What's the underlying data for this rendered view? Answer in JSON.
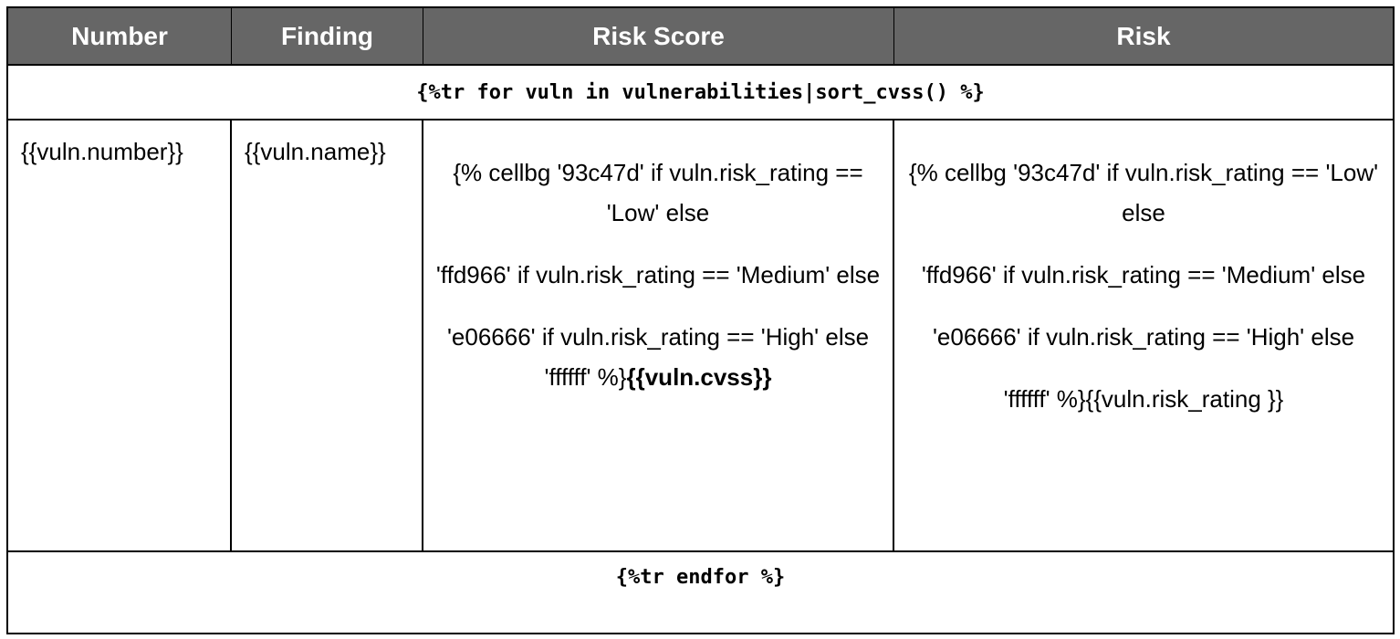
{
  "table": {
    "headers": [
      "Number",
      "Finding",
      "Risk Score",
      "Risk"
    ],
    "loop_start": "{%tr for vuln in vulnerabilities|sort_cvss() %}",
    "row": {
      "number": "{{vuln.number}}",
      "finding": "{{vuln.name}}",
      "risk_score": {
        "para1": "{% cellbg '93c47d' if vuln.risk_rating == 'Low' else",
        "para2": "'ffd966' if vuln.risk_rating == 'Medium' else",
        "para3": "'e06666' if vuln.risk_rating == 'High' else",
        "para4_prefix": "'ffffff' %}",
        "para4_bold": "{{vuln.cvss}}"
      },
      "risk": {
        "para1": "{% cellbg '93c47d' if vuln.risk_rating == 'Low' else",
        "para2": "'ffd966' if vuln.risk_rating == 'Medium' else",
        "para3": "'e06666' if vuln.risk_rating == 'High' else",
        "para4": "'ffffff' %}{{vuln.risk_rating }}"
      }
    },
    "loop_end": "{%tr endfor %}"
  },
  "colors": {
    "header_bg": "#666666",
    "header_text": "#ffffff",
    "spellcheck_underline": "#d40000"
  }
}
